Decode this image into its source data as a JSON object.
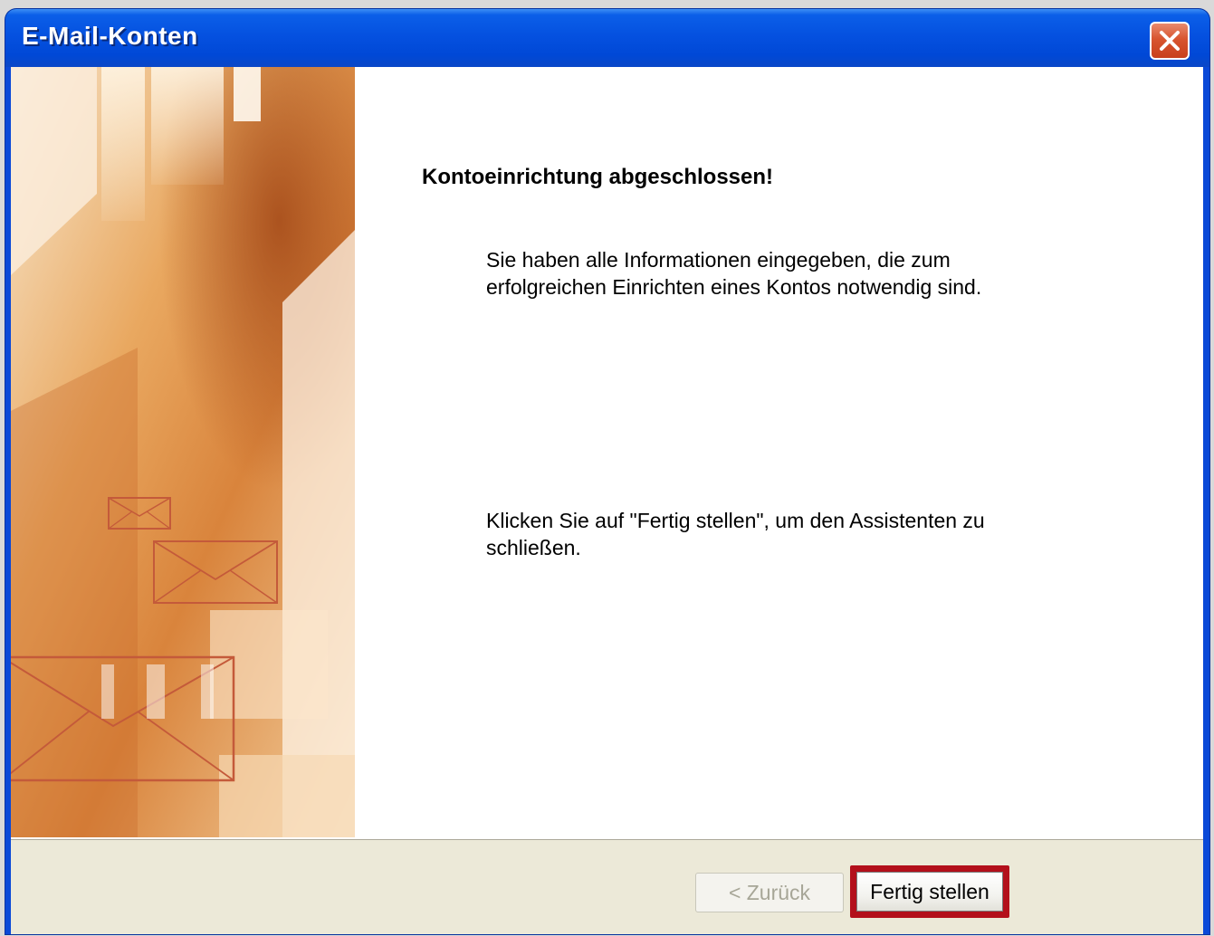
{
  "window": {
    "title": "E-Mail-Konten",
    "close_icon": "close-icon"
  },
  "content": {
    "heading": "Kontoeinrichtung abgeschlossen!",
    "paragraph1_line1": "Sie haben alle Informationen eingegeben, die zum",
    "paragraph1_line2": "erfolgreichen Einrichten eines Kontos notwendig sind.",
    "paragraph2_line1": "Klicken Sie auf \"Fertig stellen\", um den Assistenten zu",
    "paragraph2_line2": "schließen."
  },
  "footer": {
    "back_label": "< Zurück",
    "finish_label": "Fertig stellen"
  },
  "colors": {
    "titlebar": "#0551e0",
    "highlight": "#b3101b",
    "footer_bg": "#ece9d8"
  }
}
